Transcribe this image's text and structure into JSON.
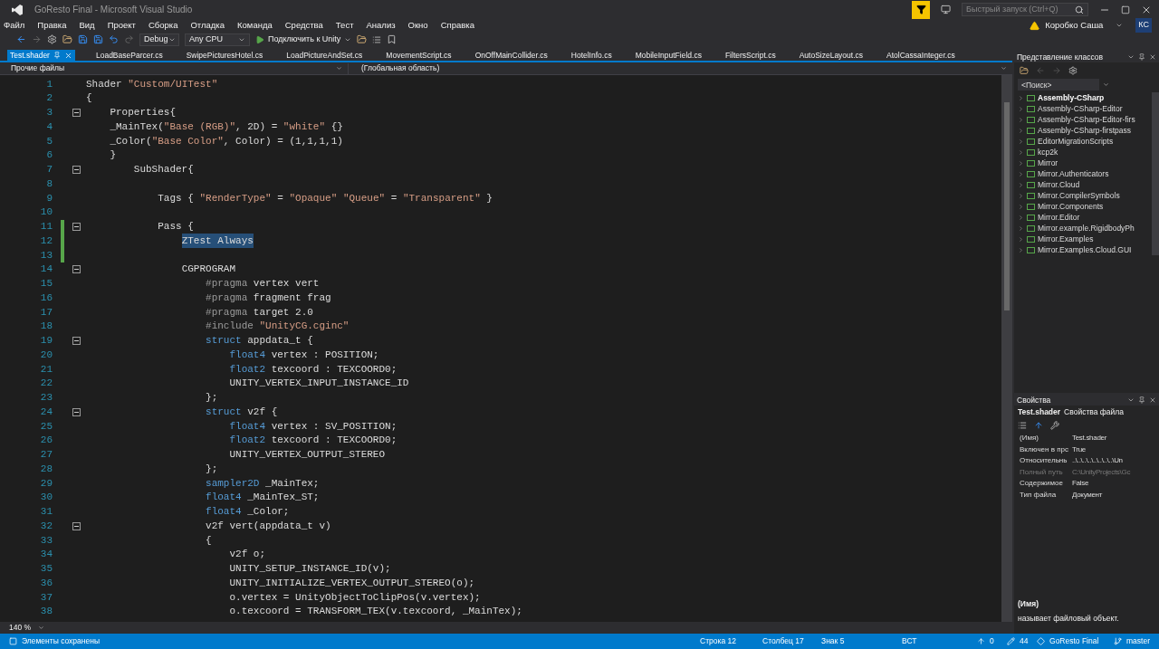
{
  "window": {
    "title": "GoResto Final - Microsoft Visual Studio",
    "quick_launch": {
      "placeholder": "Быстрый запуск (Ctrl+Q)"
    },
    "user": {
      "name": "Коробко Саша",
      "initials": "КС"
    }
  },
  "menu": [
    "Файл",
    "Правка",
    "Вид",
    "Проект",
    "Сборка",
    "Отладка",
    "Команда",
    "Средства",
    "Тест",
    "Анализ",
    "Окно",
    "Справка"
  ],
  "toolbar": {
    "configuration": "Debug",
    "platform": "Any CPU",
    "run_button": "Подключить к Unity"
  },
  "tabs": [
    {
      "label": "Test.shader",
      "selected": true
    },
    {
      "label": "LoadBaseParcer.cs",
      "selected": false
    },
    {
      "label": "SwipePicturesHotel.cs",
      "selected": false
    },
    {
      "label": "LoadPictureAndSet.cs",
      "selected": false
    },
    {
      "label": "MovementScript.cs",
      "selected": false
    },
    {
      "label": "OnOffMainCollider.cs",
      "selected": false
    },
    {
      "label": "HotelInfo.cs",
      "selected": false
    },
    {
      "label": "MobileInputField.cs",
      "selected": false
    },
    {
      "label": "FiltersScript.cs",
      "selected": false
    },
    {
      "label": "AutoSizeLayout.cs",
      "selected": false
    },
    {
      "label": "AtolCassaInteger.cs",
      "selected": false
    }
  ],
  "navigation": {
    "project": "Прочие файлы",
    "scope": "(Глобальная область)"
  },
  "code_lines": [
    {
      "number": "1",
      "fold": false,
      "changed": false,
      "tokens": [
        {
          "kind": "plain",
          "text": "Shader "
        },
        {
          "kind": "string",
          "text": "\"Custom/UITest\""
        }
      ]
    },
    {
      "number": "2",
      "fold": false,
      "changed": false,
      "tokens": [
        {
          "kind": "plain",
          "text": "{"
        }
      ]
    },
    {
      "number": "3",
      "fold": true,
      "changed": false,
      "tokens": [
        {
          "kind": "plain",
          "text": "    Properties{"
        }
      ]
    },
    {
      "number": "4",
      "fold": false,
      "changed": false,
      "tokens": [
        {
          "kind": "plain",
          "text": "    _MainTex("
        },
        {
          "kind": "string",
          "text": "\"Base (RGB)\""
        },
        {
          "kind": "plain",
          "text": ", 2D) = "
        },
        {
          "kind": "string",
          "text": "\"white\""
        },
        {
          "kind": "plain",
          "text": " {}"
        }
      ]
    },
    {
      "number": "5",
      "fold": false,
      "changed": false,
      "tokens": [
        {
          "kind": "plain",
          "text": "    _Color("
        },
        {
          "kind": "string",
          "text": "\"Base Color\""
        },
        {
          "kind": "plain",
          "text": ", Color) = (1,1,1,1)"
        }
      ]
    },
    {
      "number": "6",
      "fold": false,
      "changed": false,
      "tokens": [
        {
          "kind": "plain",
          "text": "    }"
        }
      ]
    },
    {
      "number": "7",
      "fold": true,
      "changed": false,
      "tokens": [
        {
          "kind": "plain",
          "text": "        SubShader{"
        }
      ]
    },
    {
      "number": "8",
      "fold": false,
      "changed": false
    },
    {
      "number": "9",
      "fold": false,
      "changed": false,
      "tokens": [
        {
          "kind": "plain",
          "text": "            Tags { "
        },
        {
          "kind": "string",
          "text": "\"RenderType\""
        },
        {
          "kind": "plain",
          "text": " = "
        },
        {
          "kind": "string",
          "text": "\"Opaque\""
        },
        {
          "kind": "string",
          "text": " \"Queue\""
        },
        {
          "kind": "plain",
          "text": " = "
        },
        {
          "kind": "string",
          "text": "\"Transparent\""
        },
        {
          "kind": "plain",
          "text": " }"
        }
      ]
    },
    {
      "number": "10",
      "fold": false,
      "changed": false
    },
    {
      "number": "11",
      "fold": true,
      "changed": true,
      "tokens": [
        {
          "kind": "plain",
          "text": "            Pass {"
        }
      ]
    },
    {
      "number": "12",
      "fold": false,
      "changed": true,
      "tokens": [
        {
          "kind": "selection",
          "text": "                ZTest Always"
        }
      ]
    },
    {
      "number": "13",
      "fold": false,
      "changed": true
    },
    {
      "number": "14",
      "fold": true,
      "changed": false,
      "tokens": [
        {
          "kind": "plain",
          "text": "                CGPROGRAM"
        }
      ]
    },
    {
      "number": "15",
      "fold": false,
      "changed": false,
      "tokens": [
        {
          "kind": "preprocessor",
          "text": "                    #pragma"
        },
        {
          "kind": "plain",
          "text": " vertex vert"
        }
      ]
    },
    {
      "number": "16",
      "fold": false,
      "changed": false,
      "tokens": [
        {
          "kind": "preprocessor",
          "text": "                    #pragma"
        },
        {
          "kind": "plain",
          "text": " fragment frag"
        }
      ]
    },
    {
      "number": "17",
      "fold": false,
      "changed": false,
      "tokens": [
        {
          "kind": "preprocessor",
          "text": "                    #pragma"
        },
        {
          "kind": "plain",
          "text": " target 2.0"
        }
      ]
    },
    {
      "number": "18",
      "fold": false,
      "changed": false,
      "tokens": [
        {
          "kind": "preprocessor",
          "text": "                    #include"
        },
        {
          "kind": "string",
          "text": " \"UnityCG.cginc\""
        }
      ]
    },
    {
      "number": "19",
      "fold": true,
      "changed": false,
      "tokens": [
        {
          "kind": "keyword",
          "text": "                    struct"
        },
        {
          "kind": "plain",
          "text": " appdata_t {"
        }
      ]
    },
    {
      "number": "20",
      "fold": false,
      "changed": false,
      "tokens": [
        {
          "kind": "keyword",
          "text": "                        float4"
        },
        {
          "kind": "plain",
          "text": " vertex : POSITION;"
        }
      ]
    },
    {
      "number": "21",
      "fold": false,
      "changed": false,
      "tokens": [
        {
          "kind": "keyword",
          "text": "                        float2"
        },
        {
          "kind": "plain",
          "text": " texcoord : TEXCOORD0;"
        }
      ]
    },
    {
      "number": "22",
      "fold": false,
      "changed": false,
      "tokens": [
        {
          "kind": "plain",
          "text": "                        UNITY_VERTEX_INPUT_INSTANCE_ID"
        }
      ]
    },
    {
      "number": "23",
      "fold": false,
      "changed": false,
      "tokens": [
        {
          "kind": "plain",
          "text": "                    };"
        }
      ]
    },
    {
      "number": "24",
      "fold": true,
      "changed": false,
      "tokens": [
        {
          "kind": "keyword",
          "text": "                    struct"
        },
        {
          "kind": "plain",
          "text": " v2f {"
        }
      ]
    },
    {
      "number": "25",
      "fold": false,
      "changed": false,
      "tokens": [
        {
          "kind": "keyword",
          "text": "                        float4"
        },
        {
          "kind": "plain",
          "text": " vertex : SV_POSITION;"
        }
      ]
    },
    {
      "number": "26",
      "fold": false,
      "changed": false,
      "tokens": [
        {
          "kind": "keyword",
          "text": "                        float2"
        },
        {
          "kind": "plain",
          "text": " texcoord : TEXCOORD0;"
        }
      ]
    },
    {
      "number": "27",
      "fold": false,
      "changed": false,
      "tokens": [
        {
          "kind": "plain",
          "text": "                        UNITY_VERTEX_OUTPUT_STEREO"
        }
      ]
    },
    {
      "number": "28",
      "fold": false,
      "changed": false,
      "tokens": [
        {
          "kind": "plain",
          "text": "                    };"
        }
      ]
    },
    {
      "number": "29",
      "fold": false,
      "changed": false,
      "tokens": [
        {
          "kind": "keyword",
          "text": "                    sampler2D"
        },
        {
          "kind": "plain",
          "text": " _MainTex;"
        }
      ]
    },
    {
      "number": "30",
      "fold": false,
      "changed": false,
      "tokens": [
        {
          "kind": "keyword",
          "text": "                    float4"
        },
        {
          "kind": "plain",
          "text": " _MainTex_ST;"
        }
      ]
    },
    {
      "number": "31",
      "fold": false,
      "changed": false,
      "tokens": [
        {
          "kind": "keyword",
          "text": "                    float4"
        },
        {
          "kind": "plain",
          "text": " _Color;"
        }
      ]
    },
    {
      "number": "32",
      "fold": true,
      "changed": false,
      "tokens": [
        {
          "kind": "plain",
          "text": "                    v2f vert(appdata_t v)"
        }
      ]
    },
    {
      "number": "33",
      "fold": false,
      "changed": false,
      "tokens": [
        {
          "kind": "plain",
          "text": "                    {"
        }
      ]
    },
    {
      "number": "34",
      "fold": false,
      "changed": false,
      "tokens": [
        {
          "kind": "plain",
          "text": "                        v2f o;"
        }
      ]
    },
    {
      "number": "35",
      "fold": false,
      "changed": false,
      "tokens": [
        {
          "kind": "plain",
          "text": "                        UNITY_SETUP_INSTANCE_ID(v);"
        }
      ]
    },
    {
      "number": "36",
      "fold": false,
      "changed": false,
      "tokens": [
        {
          "kind": "plain",
          "text": "                        UNITY_INITIALIZE_VERTEX_OUTPUT_STEREO(o);"
        }
      ]
    },
    {
      "number": "37",
      "fold": false,
      "changed": false,
      "tokens": [
        {
          "kind": "plain",
          "text": "                        o.vertex = UnityObjectToClipPos(v.vertex);"
        }
      ]
    },
    {
      "number": "38",
      "fold": false,
      "changed": false,
      "tokens": [
        {
          "kind": "plain",
          "text": "                        o.texcoord = TRANSFORM_TEX(v.texcoord, _MainTex);"
        }
      ]
    }
  ],
  "zoom": "140 %",
  "class_view": {
    "title": "Представление классов",
    "search": {
      "placeholder": "<Поиск>"
    },
    "items": [
      {
        "label": "Assembly-CSharp",
        "selected": true
      },
      {
        "label": "Assembly-CSharp-Editor",
        "selected": false
      },
      {
        "label": "Assembly-CSharp-Editor-firs",
        "selected": false
      },
      {
        "label": "Assembly-CSharp-firstpass",
        "selected": false
      },
      {
        "label": "EditorMigrationScripts",
        "selected": false
      },
      {
        "label": "kcp2k",
        "selected": false
      },
      {
        "label": "Mirror",
        "selected": false
      },
      {
        "label": "Mirror.Authenticators",
        "selected": false
      },
      {
        "label": "Mirror.Cloud",
        "selected": false
      },
      {
        "label": "Mirror.CompilerSymbols",
        "selected": false
      },
      {
        "label": "Mirror.Components",
        "selected": false
      },
      {
        "label": "Mirror.Editor",
        "selected": false
      },
      {
        "label": "Mirror.example.RigidbodyPh",
        "selected": false
      },
      {
        "label": "Mirror.Examples",
        "selected": false
      },
      {
        "label": "Mirror.Examples.Cloud.GUI",
        "selected": false
      }
    ]
  },
  "properties": {
    "title": "Свойства",
    "object": "Test.shader",
    "object_type": "Свойства файла",
    "rows": [
      {
        "name": "(Имя)",
        "value": "Test.shader",
        "disabled": false
      },
      {
        "name": "Включен в прс",
        "value": "True",
        "disabled": false
      },
      {
        "name": "Относительнь",
        "value": "..\\..\\..\\..\\..\\..\\..\\..\\Un",
        "disabled": false
      },
      {
        "name": "Полный путь",
        "value": "C:\\UnityProjects\\Gc",
        "disabled": true
      },
      {
        "name": "Содержимое",
        "value": "False",
        "disabled": false
      },
      {
        "name": "Тип файла",
        "value": "Документ",
        "disabled": false
      }
    ],
    "description_title": "(Имя)",
    "description": "называет файловый объект."
  },
  "status_bar": {
    "message": "Элементы сохранены",
    "line": "Строка 12",
    "column": "Столбец 17",
    "char": "Знак 5",
    "mode": "ВСТ",
    "pushes": "0",
    "changes": "44",
    "repository": "GoResto Final",
    "branch": "master"
  }
}
